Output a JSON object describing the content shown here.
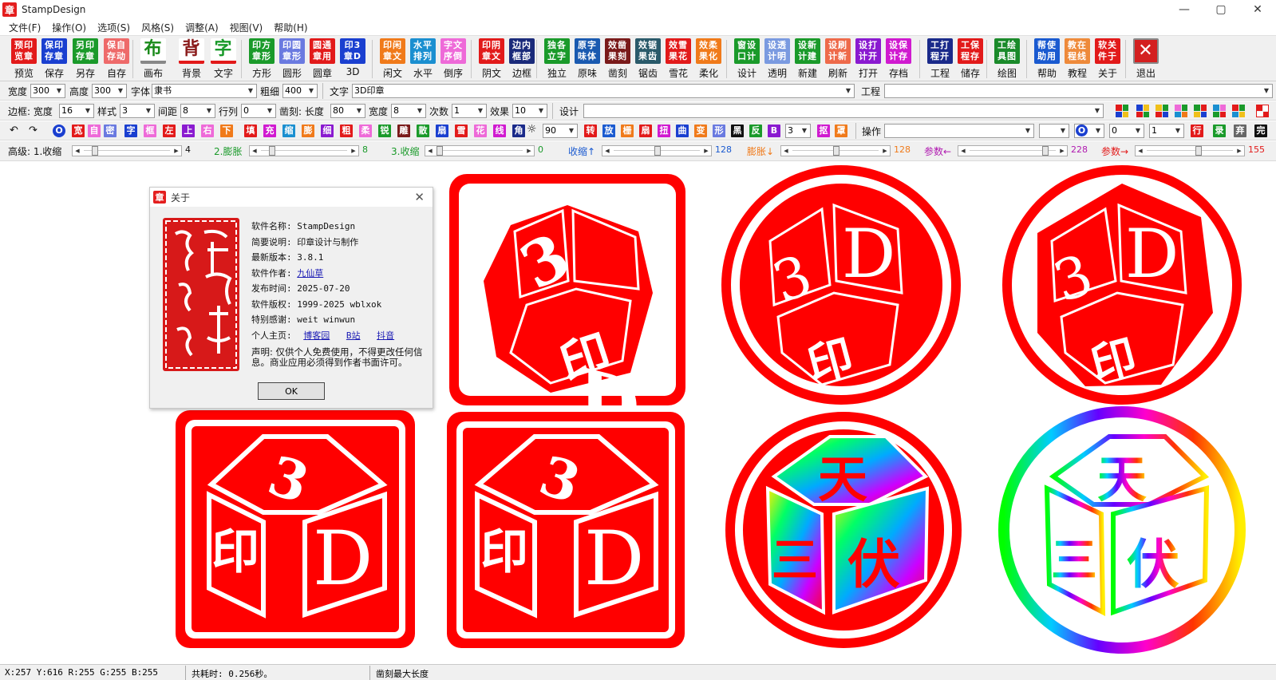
{
  "window": {
    "title": "StampDesign",
    "icon_glyph": "章",
    "minimize": "—",
    "maximize": "▢",
    "close": "✕"
  },
  "menu": [
    "文件(F)",
    "操作(O)",
    "选项(S)",
    "风格(S)",
    "调整(A)",
    "视图(V)",
    "帮助(H)"
  ],
  "toolbar": {
    "buttons": [
      {
        "icon": "预印览章",
        "label": "预览",
        "color": "#e21a1a"
      },
      {
        "icon": "保印存章",
        "label": "保存",
        "color": "#1a3fd0"
      },
      {
        "icon": "另印存章",
        "label": "另存",
        "color": "#1a9a2a"
      },
      {
        "icon": "保自存动",
        "label": "自存",
        "color": "#ee6a6a"
      },
      {
        "icon": "布",
        "label": "画布",
        "color": "#ffffff"
      },
      {
        "icon": "背",
        "label": "背景",
        "color": "#ffffff"
      },
      {
        "icon": "字",
        "label": "文字",
        "color": "#ffffff"
      },
      {
        "icon": "印方章形",
        "label": "方形",
        "color": "#1a9a2a"
      },
      {
        "icon": "印圆章形",
        "label": "圆形",
        "color": "#6a7ae0"
      },
      {
        "icon": "圆通章用",
        "label": "圆章",
        "color": "#e21a1a"
      },
      {
        "icon": "印3章D",
        "label": "3D",
        "color": "#1a3fd0"
      },
      {
        "icon": "印闲章文",
        "label": "闲文",
        "color": "#f07a1a"
      },
      {
        "icon": "水平排列",
        "label": "水平",
        "color": "#1a8fd0"
      },
      {
        "icon": "字文序倒",
        "label": "倒序",
        "color": "#ee6ad8"
      },
      {
        "icon": "印阴章文",
        "label": "阴文",
        "color": "#e21a1a"
      },
      {
        "icon": "边内框部",
        "label": "边框",
        "color": "#1a2a7a"
      },
      {
        "icon": "独各立字",
        "label": "独立",
        "color": "#1a9a2a"
      },
      {
        "icon": "原字味体",
        "label": "原味",
        "color": "#1a5ab0"
      },
      {
        "icon": "效凿果刻",
        "label": "凿刻",
        "color": "#7a1a1a"
      },
      {
        "icon": "效锯果齿",
        "label": "锯齿",
        "color": "#2a5a6a"
      },
      {
        "icon": "效雪果花",
        "label": "雪花",
        "color": "#e21a1a"
      },
      {
        "icon": "效柔果化",
        "label": "柔化",
        "color": "#f07a1a"
      },
      {
        "icon": "窗设口计",
        "label": "设计",
        "color": "#1a9a2a"
      },
      {
        "icon": "设透计明",
        "label": "透明",
        "color": "#7a9ae0"
      },
      {
        "icon": "设新计建",
        "label": "新建",
        "color": "#1a9a2a"
      },
      {
        "icon": "设刷计新",
        "label": "刷新",
        "color": "#ee6a4a"
      },
      {
        "icon": "设打计开",
        "label": "打开",
        "color": "#8a1ad0"
      },
      {
        "icon": "设保计存",
        "label": "存档",
        "color": "#d01ad0"
      },
      {
        "icon": "工打程开",
        "label": "工程",
        "color": "#1a2a8a"
      },
      {
        "icon": "工保程存",
        "label": "储存",
        "color": "#e21a1a"
      },
      {
        "icon": "工绘具图",
        "label": "绘图",
        "color": "#1a8a2a"
      },
      {
        "icon": "帮使助用",
        "label": "帮助",
        "color": "#1a5ad0"
      },
      {
        "icon": "教在程线",
        "label": "教程",
        "color": "#ee8a3a"
      },
      {
        "icon": "软关件于",
        "label": "关于",
        "color": "#e21a1a"
      },
      {
        "icon": "✕",
        "label": "退出",
        "color": "#d42020"
      }
    ]
  },
  "row1": {
    "width_label": "宽度",
    "width": "300",
    "height_label": "高度",
    "height": "300",
    "font_label": "字体",
    "font": "隶书",
    "weight_label": "粗细",
    "weight": "400",
    "text_label": "文字",
    "text": "3D印章",
    "project_label": "工程",
    "project": ""
  },
  "row2": {
    "border_label": "边框: 宽度",
    "border_width": "16",
    "style_label": "样式",
    "style": "3",
    "spacing_label": "间距",
    "spacing": "8",
    "rowgap_label": "行列",
    "rowgap": "0",
    "chisel_label": "凿刻: 长度",
    "chisel_len": "80",
    "chisel_w_label": "宽度",
    "chisel_w": "8",
    "times_label": "次数",
    "times": "1",
    "effect_label": "效果",
    "effect": "10",
    "design_label": "设计",
    "design": ""
  },
  "row3": {
    "chars": [
      {
        "t": "宽",
        "c": "#e21a1a"
      },
      {
        "t": "自",
        "c": "#ee6ad8"
      },
      {
        "t": "密",
        "c": "#6a7ae0"
      },
      {
        "t": "字",
        "c": "#1a3fd0"
      },
      {
        "t": "框",
        "c": "#ee6ad8"
      },
      {
        "t": "左",
        "c": "#e21a1a"
      },
      {
        "t": "上",
        "c": "#8a1ad0"
      },
      {
        "t": "右",
        "c": "#ee6ad8"
      },
      {
        "t": "下",
        "c": "#f07a1a"
      },
      {
        "t": "填",
        "c": "#e21a1a"
      },
      {
        "t": "充",
        "c": "#d01ad0"
      },
      {
        "t": "缩",
        "c": "#1a8fd0"
      },
      {
        "t": "膨",
        "c": "#f07a1a"
      },
      {
        "t": "细",
        "c": "#8a1ad0"
      },
      {
        "t": "粗",
        "c": "#e21a1a"
      },
      {
        "t": "柔",
        "c": "#ee6ad8"
      },
      {
        "t": "锐",
        "c": "#1a9a2a"
      },
      {
        "t": "雕",
        "c": "#7a1a1a"
      },
      {
        "t": "散",
        "c": "#1a9a2a"
      },
      {
        "t": "扇",
        "c": "#1a3fd0"
      },
      {
        "t": "雪",
        "c": "#e21a1a"
      },
      {
        "t": "花",
        "c": "#ee6ad8"
      },
      {
        "t": "线",
        "c": "#d01ad0"
      },
      {
        "t": "角",
        "c": "#1a2a8a"
      }
    ],
    "angle": "90",
    "chars2": [
      {
        "t": "转",
        "c": "#e21a1a"
      },
      {
        "t": "放",
        "c": "#1a5ad0"
      },
      {
        "t": "栅",
        "c": "#f07a1a"
      },
      {
        "t": "扇",
        "c": "#e21a1a"
      },
      {
        "t": "扭",
        "c": "#d01ad0"
      },
      {
        "t": "曲",
        "c": "#1a3fd0"
      },
      {
        "t": "变",
        "c": "#f07a1a"
      },
      {
        "t": "形",
        "c": "#6a7ae0"
      },
      {
        "t": "黑",
        "c": "#111111"
      },
      {
        "t": "反",
        "c": "#1a9a2a"
      },
      {
        "t": "B",
        "c": "#8a1ad0"
      }
    ],
    "count": "3",
    "chars3": [
      {
        "t": "抠",
        "c": "#d01ad0"
      },
      {
        "t": "罩",
        "c": "#f07a1a"
      }
    ],
    "op_label": "操作",
    "op": "",
    "op2": "",
    "zero": "0",
    "one": "1",
    "chars4": [
      {
        "t": "行",
        "c": "#e21a1a"
      },
      {
        "t": "录",
        "c": "#1a9a2a"
      },
      {
        "t": "弃",
        "c": "#666666"
      },
      {
        "t": "完",
        "c": "#111111"
      }
    ]
  },
  "row4": {
    "advanced_label": "高级: 1.收缩",
    "v1": "4",
    "l2": "2.膨胀",
    "v2": "8",
    "l3": "3.收缩",
    "v3": "0",
    "l4": "收缩↑",
    "v4": "128",
    "l5": "膨胀↓",
    "v5": "128",
    "l6": "参数←",
    "v6": "228",
    "l7": "参数→",
    "v7": "155"
  },
  "about": {
    "title": "关于",
    "close": "✕",
    "rows": [
      {
        "k": "软件名称:",
        "v": "StampDesign"
      },
      {
        "k": "简要说明:",
        "v": "印章设计与制作"
      },
      {
        "k": "最新版本:",
        "v": "3.8.1"
      },
      {
        "k": "软件作者:",
        "v": "九仙草",
        "link": true
      },
      {
        "k": "发布时间:",
        "v": "2025-07-20"
      },
      {
        "k": "软件版权:",
        "v": "1999-2025 wblxok"
      },
      {
        "k": "特别感谢:",
        "v": "weit winwun"
      }
    ],
    "homepage_label": "个人主页:",
    "links": [
      "博客园",
      "B站",
      "抖音"
    ],
    "declaration": "声明: 仅供个人免费使用，不得更改任何信息。商业应用必须得到作者书面许可。",
    "ok": "OK"
  },
  "stamps": {
    "d3_top": [
      "3",
      "D",
      "印"
    ],
    "d3_flat": [
      "3",
      "印",
      "D"
    ],
    "rainbow": [
      "天",
      "三",
      "伏"
    ],
    "colors": {
      "red": "#ff0000",
      "white": "#ffffff"
    }
  },
  "status": {
    "pixel": "X:257 Y:616 R:255 G:255 B:255",
    "time": "共耗时: 0.256秒。",
    "hint": "凿刻最大长度"
  }
}
